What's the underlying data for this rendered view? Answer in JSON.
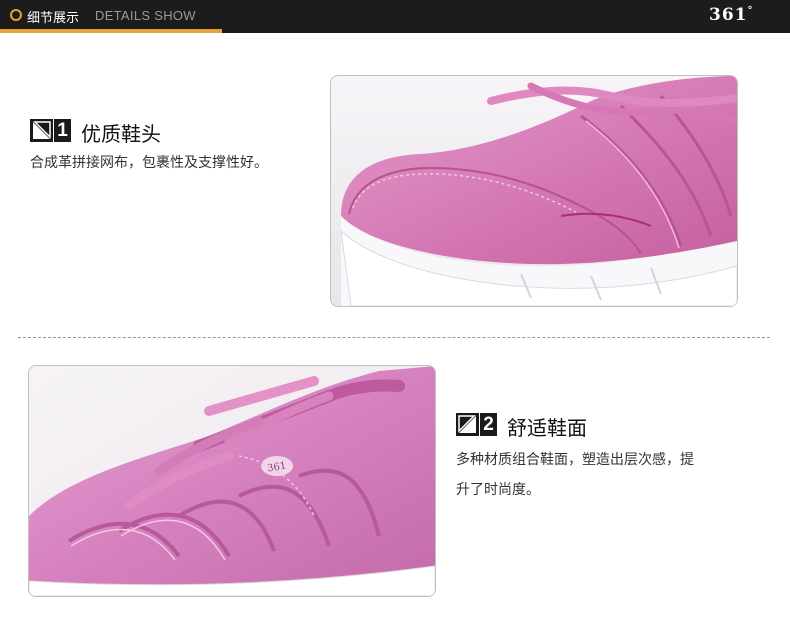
{
  "header": {
    "title": "细节展示",
    "subtitle": "DETAILS SHOW",
    "brand_logo": "361",
    "brand_degree": "°"
  },
  "features": [
    {
      "number": "1",
      "title": "优质鞋头",
      "description_lines": [
        "合成革拼接网布，包裹性及支撑性好。"
      ]
    },
    {
      "number": "2",
      "title": "舒适鞋面",
      "description_lines": [
        "多种材质组合鞋面，塑造出层次感，提",
        "升了时尚度。"
      ]
    }
  ],
  "images": {
    "toe_photo": "pink-shoe-toe-photo",
    "upper_photo": "pink-shoe-upper-photo",
    "shoe_logo_text": "361"
  },
  "colors": {
    "header_bg": "#1c1c1c",
    "accent_orange": "#e8a23a",
    "shoe_pink": "#d879b6",
    "sole_white": "#f6f4f8"
  }
}
